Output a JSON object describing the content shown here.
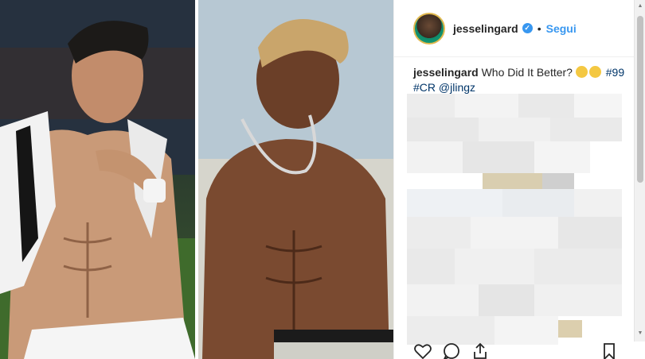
{
  "post": {
    "author": {
      "username": "jesselingard",
      "verified_mark": "✓",
      "separator": "•",
      "follow_label": "Segui"
    },
    "caption": {
      "username": "jesselingard",
      "text": "Who Did It Better?",
      "hashtags_line1": "#99",
      "hashtags_line2": "#CR @jlingz"
    },
    "icons": {
      "like": "heart-icon",
      "comment": "comment-icon",
      "share": "share-icon",
      "save": "bookmark-icon"
    },
    "colors": {
      "link_blue": "#3897f0",
      "text_dark": "#262626",
      "tag_blue": "#003569"
    }
  }
}
